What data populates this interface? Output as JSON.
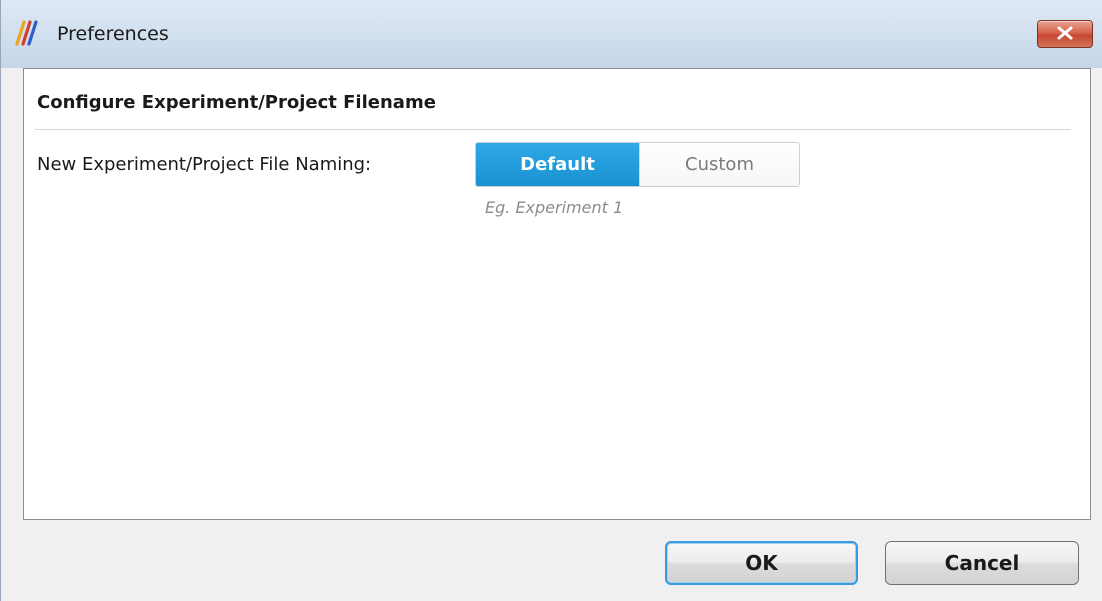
{
  "window": {
    "title": "Preferences",
    "app_icon": "app-logo-icon",
    "close_icon": "close-icon"
  },
  "section": {
    "title": "Configure Experiment/Project Filename"
  },
  "naming": {
    "label": "New Experiment/Project File Naming:",
    "options": [
      {
        "label": "Default",
        "selected": true
      },
      {
        "label": "Custom",
        "selected": false
      }
    ],
    "example": "Eg. Experiment 1"
  },
  "buttons": {
    "ok": "OK",
    "cancel": "Cancel"
  },
  "colors": {
    "accent": "#1a92d2",
    "close": "#c64732"
  }
}
